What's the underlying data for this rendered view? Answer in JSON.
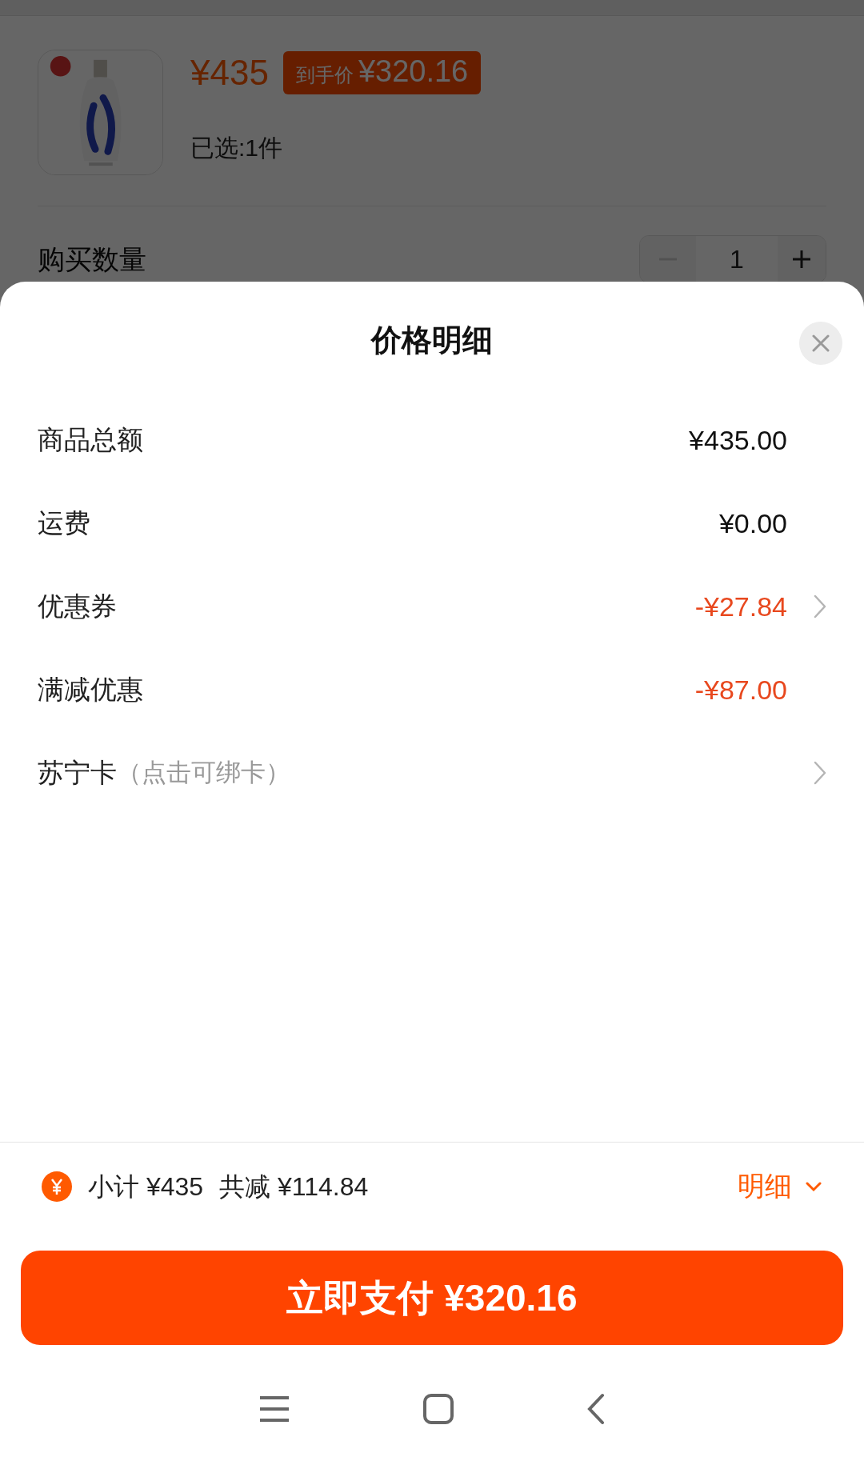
{
  "background": {
    "product": {
      "price": "¥435",
      "final_price_label": "到手价",
      "final_price": "¥320.16",
      "selected_count": "已选:1件"
    },
    "quantity": {
      "label": "购买数量",
      "value": "1",
      "minus_disabled": true
    }
  },
  "sheet": {
    "title": "价格明细",
    "rows": [
      {
        "label": "商品总额",
        "value": "¥435.00",
        "highlight": false,
        "chevron": false
      },
      {
        "label": "运费",
        "value": "¥0.00",
        "highlight": false,
        "chevron": false
      },
      {
        "label": "优惠券",
        "value": "-¥27.84",
        "highlight": true,
        "chevron": true
      },
      {
        "label": "满减优惠",
        "value": "-¥87.00",
        "highlight": true,
        "chevron": false
      },
      {
        "label": "苏宁卡",
        "note": "（点击可绑卡）",
        "chevron": true
      }
    ]
  },
  "footer": {
    "subtotal": "小计 ¥435",
    "reduction": "共减 ¥114.84",
    "detail": "明细",
    "pay_button": "立即支付 ¥320.16"
  }
}
